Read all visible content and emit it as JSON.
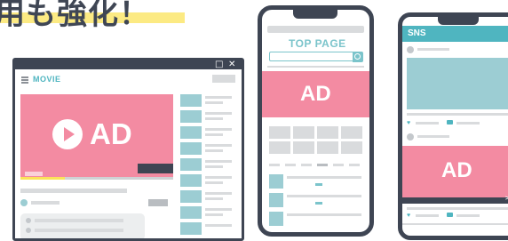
{
  "headline": {
    "text": "用も強化！"
  },
  "desktop": {
    "close_glyph": "✕",
    "maximize_glyph": "□",
    "menu_title": "MOVIE",
    "ad_label": "AD"
  },
  "phone_top": {
    "title": "TOP PAGE",
    "ad_label": "AD"
  },
  "phone_sns": {
    "title": "SNS",
    "ad_label": "AD",
    "arrow_glyph": ">"
  },
  "colors": {
    "ad_pink": "#f38ba2",
    "teal": "#4fb5c0",
    "frame": "#3e4553",
    "highlight": "#fbe35a"
  }
}
